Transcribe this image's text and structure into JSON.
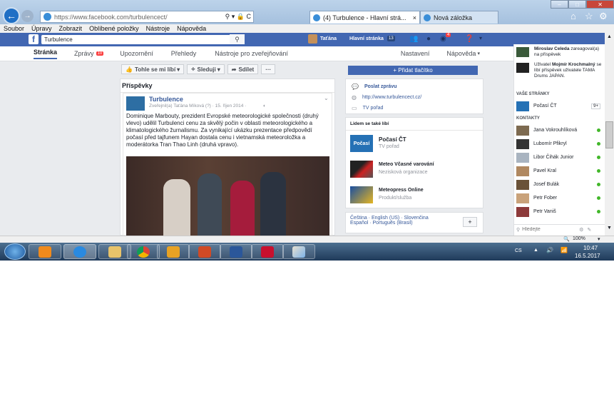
{
  "browser": {
    "address_url_host": "https://www.facebook.com",
    "address_url_path": "/turbulencect/",
    "tabs": [
      {
        "label": "(4) Turbulence - Hlavní strá...",
        "close": "×"
      },
      {
        "label": "Nová záložka"
      }
    ],
    "menu": [
      "Soubor",
      "Úpravy",
      "Zobrazit",
      "Oblíbené položky",
      "Nástroje",
      "Nápověda"
    ],
    "zoom": "100%"
  },
  "fb": {
    "search_value": "Turbulence",
    "user": "Taťána",
    "home": "Hlavní stránka",
    "home_count": "13",
    "notif_count": "4"
  },
  "subnav": {
    "items": [
      "Stránka",
      "Zprávy",
      "Upozornění",
      "Přehledy",
      "Nástroje pro zveřejňování"
    ],
    "messages_badge": "10",
    "settings": "Nastavení",
    "help": "Nápověda"
  },
  "actions": {
    "like": "Tohle se mi líbí",
    "follow": "Sleduji",
    "share": "Sdílet",
    "more": "···"
  },
  "posts_heading": "Příspěvky",
  "post": {
    "page": "Turbulence",
    "meta": "Zveřejnil(a) Taťána Míková (?) · 15. říjen 2014 ·",
    "text": "Dominique Marbouty, prezident Evropské meteorologické společnosti (druhý vlevo) udělil Turbulenci cenu za skvělý počin v oblasti meteorologického a klimatologického žurnalismu. Za vynikající ukázku prezentace předpovědí počasí před tajfunem Hayan dostala cenu i vietnamská meteoroložka a moderátorka Tran Thao Linh (druhá vpravo)."
  },
  "right_col": {
    "add_button": "+ Přidat tlačítko",
    "send_message": "Poslat zprávu",
    "website": "http://www.turbulencect.cz/",
    "tv": "TV pořad",
    "also_like_heading": "Lidem se také líbí",
    "also_like": [
      {
        "name": "Počasí ČT",
        "type": "TV pořad",
        "logo": "Počasí"
      },
      {
        "name": "Meteo Včasné varování",
        "type": "Nezisková organizace",
        "logo": ""
      },
      {
        "name": "Meteopress Online",
        "type": "Produkt/služba",
        "logo": ""
      }
    ],
    "languages_line1": "Čeština · English (US) · Slovenčina",
    "languages_line2": "Español · Português (Brasil)",
    "plus": "+"
  },
  "sidebar": {
    "ticker": [
      {
        "bold": "Miroslav Celeda",
        "rest": "zareagoval(a) na příspěvek"
      },
      {
        "pre": "Uživatel",
        "bold": "Mojmír Krochmalný",
        "rest": "se líbí příspěvek uživatele TAMA Drums JAPAN."
      }
    ],
    "pages_heading": "VAŠE STRÁNKY",
    "page_item": "Počasí ČT",
    "page_badge": "9+",
    "contacts_heading": "KONTAKTY",
    "contacts": [
      "Jana Vokrouhlíková",
      "Lubomír Pfikryl",
      "Libor Čihák Junior",
      "Pavel Kral",
      "Josef Bulák",
      "Petr Fober",
      "Petr Vaniš"
    ],
    "search_placeholder": "Hledejte"
  },
  "taskbar": {
    "lang": "CS",
    "time": "10:47",
    "date": "16.5.2017"
  },
  "colors": {
    "fb_blue": "#4267b2",
    "badge_red": "#fa3e3e",
    "online": "#42b72a"
  }
}
